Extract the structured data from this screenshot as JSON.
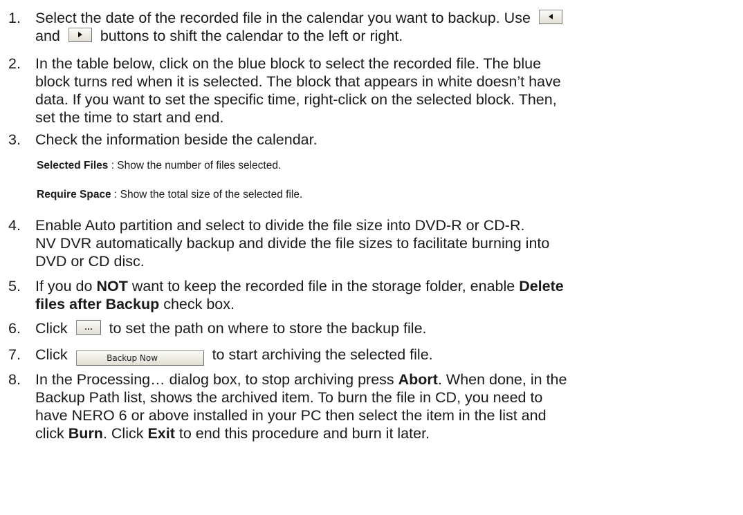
{
  "steps": [
    {
      "number": "1.",
      "line1_before": "Select the date of the recorded file in the calendar you want to backup. Use",
      "line2_before": "and",
      "line2_after": "buttons to shift the calendar to the left or right."
    },
    {
      "number": "2.",
      "lines": [
        "In the table below, click on the blue block to select the recorded file. The blue",
        "block turns red when it is selected. The block that appears in white doesn’t have",
        "data. If you want to set the specific time, right-click on the selected block. Then,",
        "set the time to start and end."
      ]
    },
    {
      "number": "3.",
      "text": "Check the information beside the calendar.",
      "sub_items": [
        {
          "term": "Selected Files",
          "desc": " : Show the number of files selected."
        },
        {
          "term": "Require Space",
          "desc": " : Show the total size of the selected file."
        }
      ]
    },
    {
      "number": "4.",
      "lines": [
        "Enable Auto partition and select to divide the file size into DVD-R or CD-R.",
        "NV DVR automatically backup and divide the file sizes to facilitate burning into",
        "DVD or CD disc."
      ]
    },
    {
      "number": "5.",
      "p1": "If you do ",
      "p1_bold": "NOT",
      "p2": " want to keep the recorded file in the storage folder, enable ",
      "p2_bold": "Delete",
      "p3_bold": "files after Backup",
      "p3": " check box."
    },
    {
      "number": "6.",
      "before": "Click",
      "after": "to set the path on where to store the backup file.",
      "button_label": "..."
    },
    {
      "number": "7.",
      "before": "Click",
      "after": "to start archiving the selected file.",
      "button_label": "Backup Now"
    },
    {
      "number": "8.",
      "l1a": "In the Processing… dialog box, to stop archiving press ",
      "l1b": "Abort",
      "l1c": ". When done, in the",
      "l2": "Backup Path list, shows the archived item. To burn the file in CD, you need to",
      "l3": "have NERO 6 or above installed in your PC then select the item in the list and",
      "l4a": "click ",
      "l4b": "Burn",
      "l4c": ". Click ",
      "l4d": "Exit",
      "l4e": " to end this procedure and burn it later."
    }
  ]
}
